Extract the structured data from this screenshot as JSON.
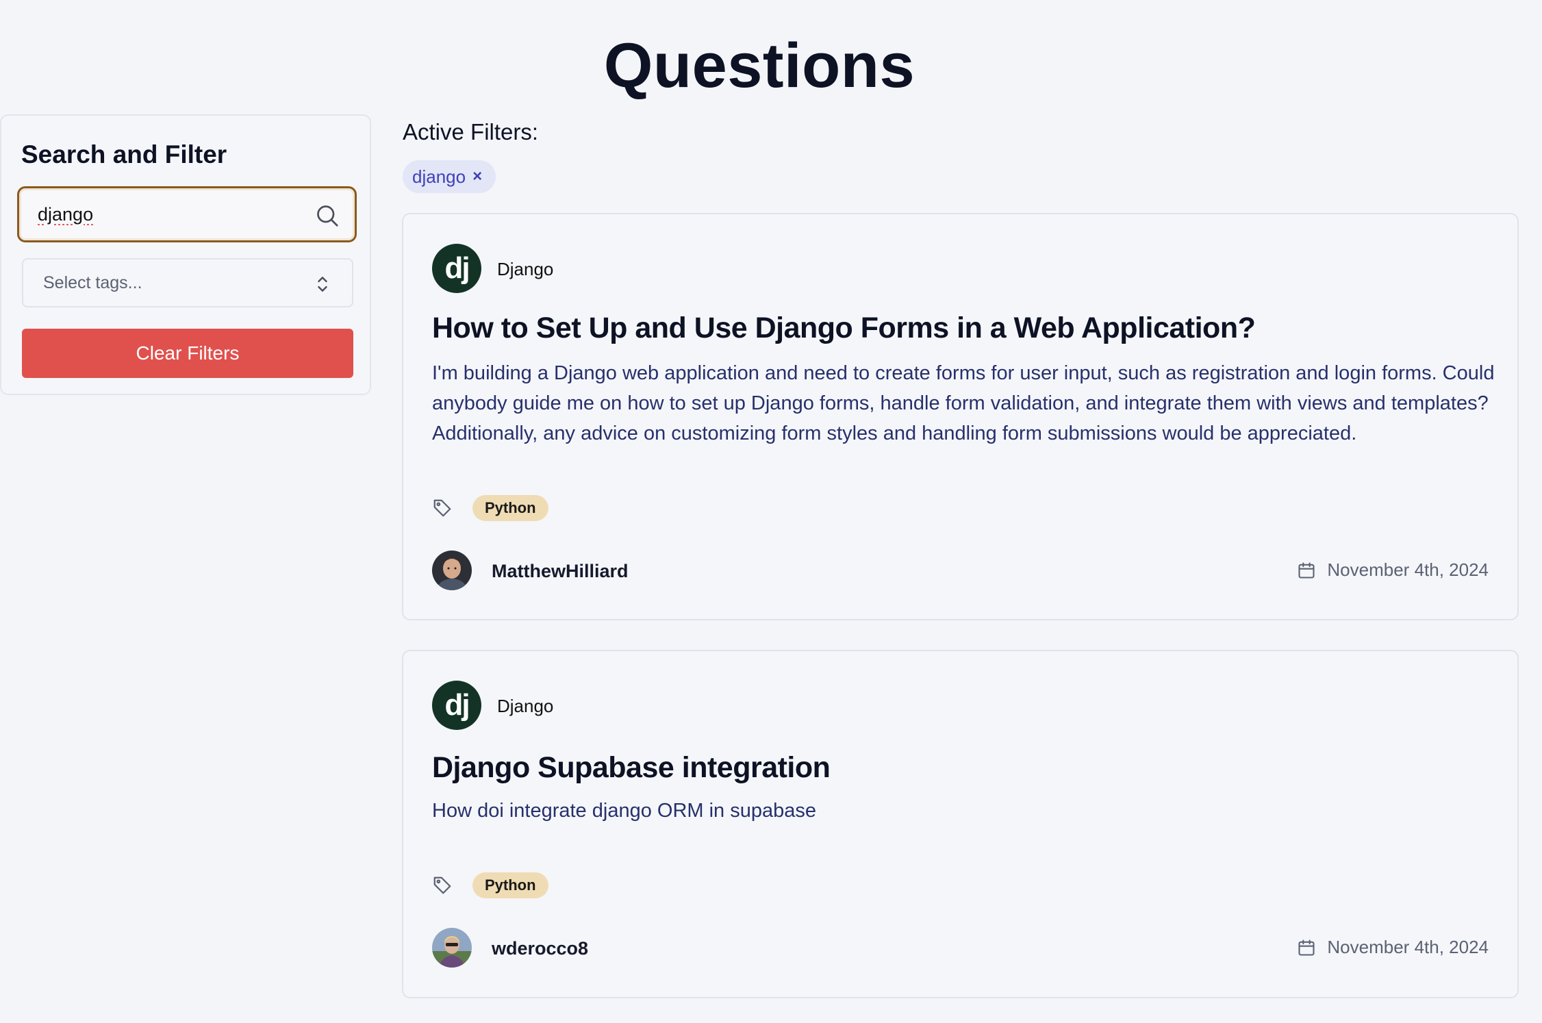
{
  "page": {
    "title": "Questions"
  },
  "sidebar": {
    "title": "Search and Filter",
    "search": {
      "value": "django",
      "icon": "search-icon"
    },
    "tags_select": {
      "placeholder": "Select tags...",
      "icon": "chevron-up-down-icon"
    },
    "clear_button": {
      "label": "Clear Filters",
      "color": "#e0514d"
    }
  },
  "active_filters": {
    "label": "Active Filters:",
    "chips": [
      {
        "label": "django",
        "remove": "×"
      }
    ]
  },
  "questions": [
    {
      "tech": {
        "logo_text": "dj",
        "name": "Django",
        "color": "#133326"
      },
      "title": "How to Set Up and Use Django Forms in a Web Application?",
      "body": "I'm building a Django web application and need to create forms for user input, such as registration and login forms. Could anybody guide me on how to set up Django forms, handle form validation, and integrate them with views and templates? Additionally, any advice on customizing form styles and handling form submissions would be appreciated.",
      "tag": "Python",
      "author": "MatthewHilliard",
      "date": "November 4th, 2024"
    },
    {
      "tech": {
        "logo_text": "dj",
        "name": "Django",
        "color": "#133326"
      },
      "title": "Django Supabase integration",
      "body": "How doi integrate django ORM in supabase",
      "tag": "Python",
      "author": "wderocco8",
      "date": "November 4th, 2024"
    }
  ]
}
